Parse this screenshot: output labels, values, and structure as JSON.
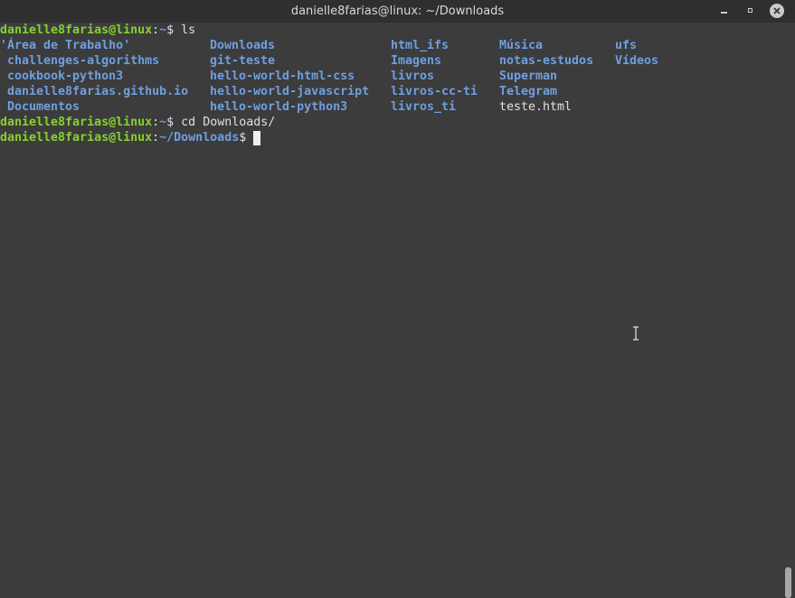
{
  "window": {
    "title": "danielle8farias@linux: ~/Downloads"
  },
  "prompt": {
    "user_host": "danielle8farias@linux",
    "colon": ":",
    "home_path": "~",
    "downloads_path": "~/Downloads",
    "dollar": "$"
  },
  "commands": {
    "first": " ls",
    "second": " cd Downloads/"
  },
  "ls_output": [
    {
      "name": "'Área de Trabalho'",
      "type": "dir"
    },
    {
      "name": " challenges-algorithms",
      "type": "dir"
    },
    {
      "name": " cookbook-python3",
      "type": "dir"
    },
    {
      "name": " danielle8farias.github.io",
      "type": "dir"
    },
    {
      "name": " Documentos",
      "type": "dir"
    },
    {
      "name": "Downloads",
      "type": "dir"
    },
    {
      "name": "git-teste",
      "type": "dir"
    },
    {
      "name": "hello-world-html-css",
      "type": "dir"
    },
    {
      "name": "hello-world-javascript",
      "type": "dir"
    },
    {
      "name": "hello-world-python3",
      "type": "dir"
    },
    {
      "name": "html_ifs",
      "type": "dir"
    },
    {
      "name": "Imagens",
      "type": "dir"
    },
    {
      "name": "livros",
      "type": "dir"
    },
    {
      "name": "livros-cc-ti",
      "type": "dir"
    },
    {
      "name": "livros_ti",
      "type": "dir"
    },
    {
      "name": "Música",
      "type": "dir"
    },
    {
      "name": "notas-estudos",
      "type": "dir"
    },
    {
      "name": "Superman",
      "type": "dir"
    },
    {
      "name": "Telegram",
      "type": "dir"
    },
    {
      "name": "teste.html",
      "type": "file"
    },
    {
      "name": "ufs",
      "type": "dir"
    },
    {
      "name": "Vídeos",
      "type": "dir"
    }
  ],
  "colors": {
    "background": "#3c3c3c",
    "prompt_user": "#87d12e",
    "prompt_path": "#6f9fe0",
    "directory": "#6f9fe0",
    "text": "#e0e0e0"
  },
  "icons": {
    "minimize": "minimize-icon",
    "maximize": "maximize-icon",
    "close": "close-icon",
    "mouse_cursor": "text-cursor-icon"
  }
}
